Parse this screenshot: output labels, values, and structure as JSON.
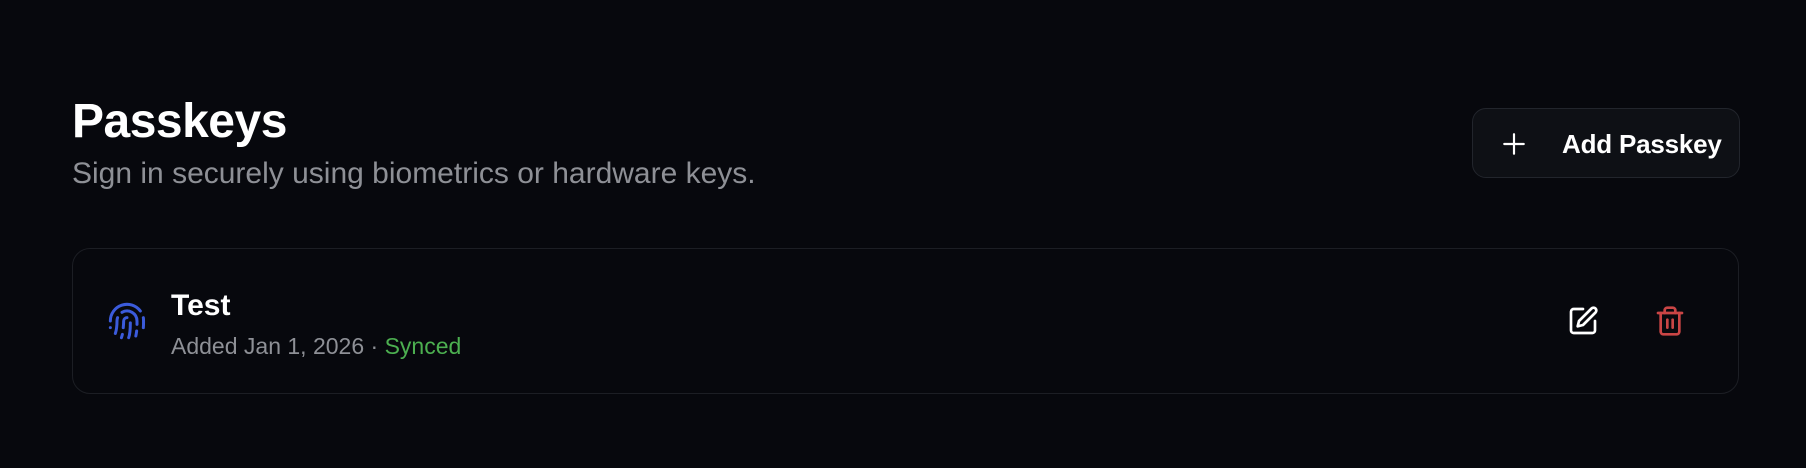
{
  "header": {
    "title": "Passkeys",
    "subtitle": "Sign in securely using biometrics or hardware keys.",
    "add_button_label": "Add Passkey",
    "add_button_icon": "plus-icon"
  },
  "passkeys": [
    {
      "name": "Test",
      "added_text": "Added Jan 1, 2026",
      "separator": "·",
      "status": "Synced",
      "icon": "fingerprint-icon",
      "actions": {
        "edit_icon": "edit-icon",
        "delete_icon": "trash-icon"
      }
    }
  ],
  "colors": {
    "background": "#07080d",
    "accent_blue": "#3b5bdb",
    "status_synced": "#4caf50",
    "danger": "#c94545",
    "muted_text": "#8e9096"
  }
}
